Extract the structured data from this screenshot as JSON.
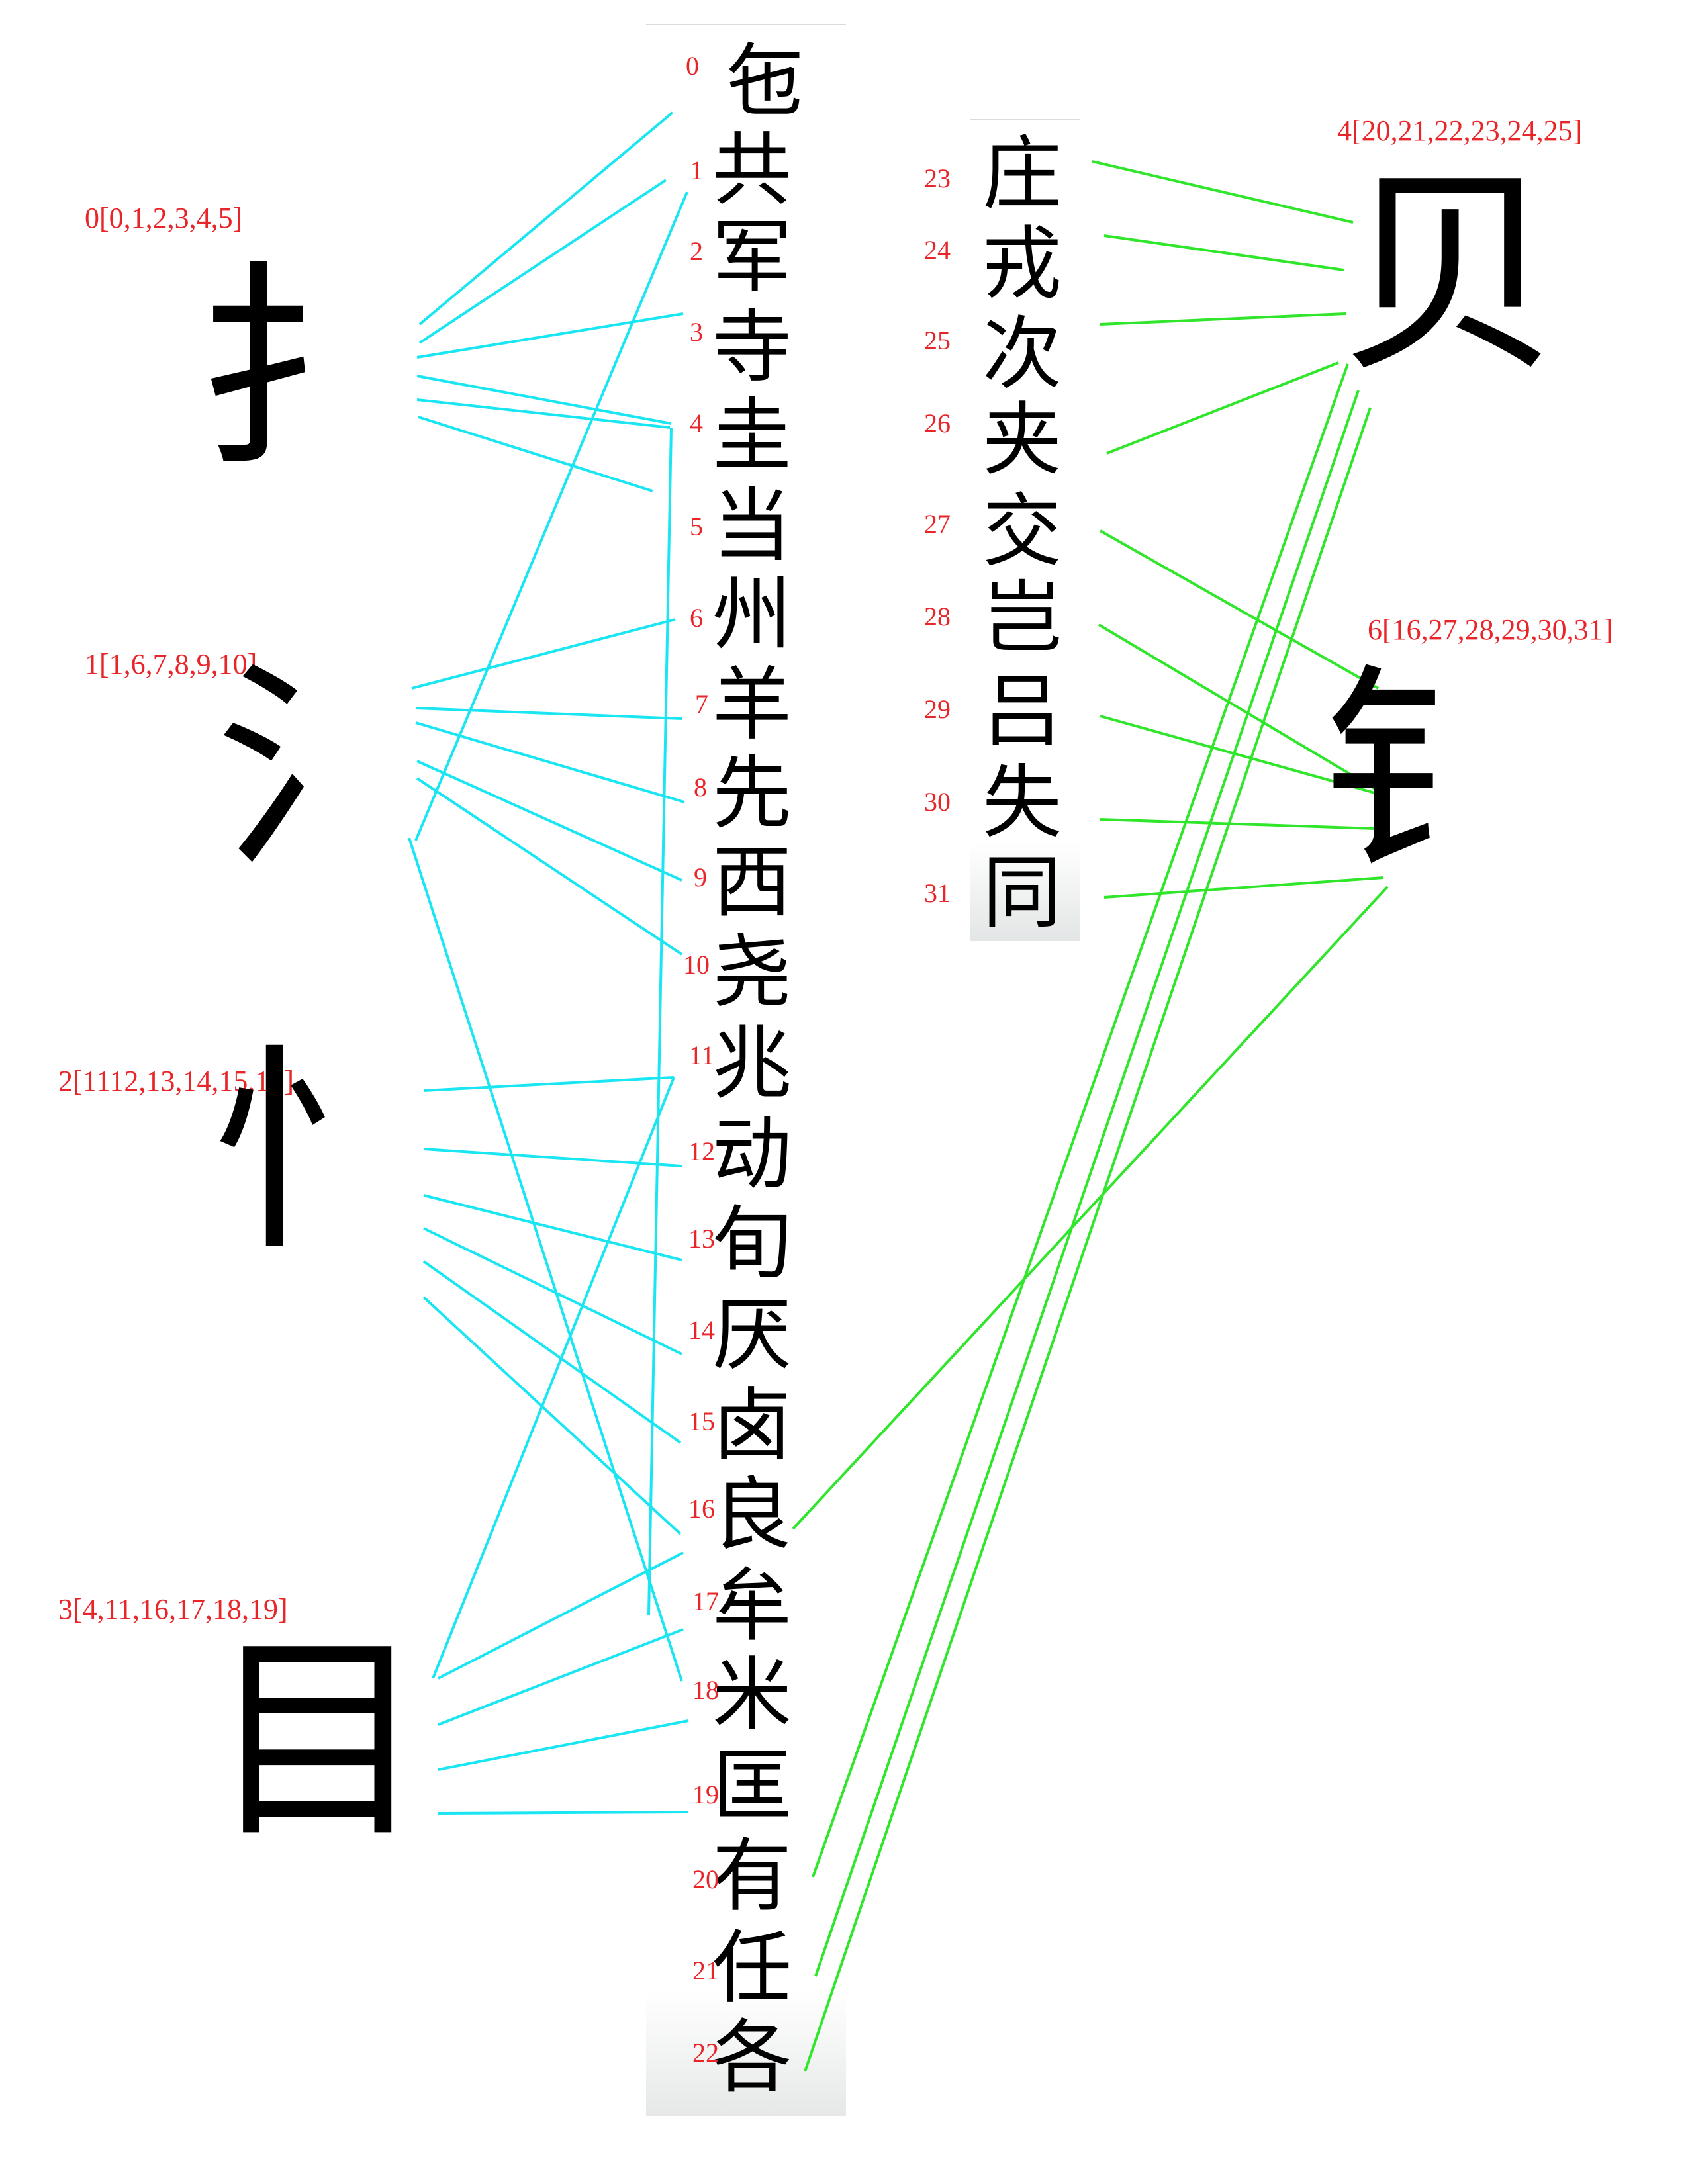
{
  "colors": {
    "label": "#e8262a",
    "link_left": "#19e6f2",
    "link_right": "#2fe62a",
    "text": "#000000"
  },
  "radicals": [
    {
      "id": 0,
      "glyph": "扌",
      "label": "0[0,1,2,3,4,5]"
    },
    {
      "id": 1,
      "glyph": "氵",
      "label": "1[1,6,7,8,9,10]"
    },
    {
      "id": 2,
      "glyph": "忄",
      "label": "2[1112,13,14,15,16]"
    },
    {
      "id": 3,
      "glyph": "目",
      "label": "3[4,11,16,17,18,19]"
    },
    {
      "id": 4,
      "glyph": "贝",
      "label": "4[20,21,22,23,24,25]"
    },
    {
      "id": 6,
      "glyph": "钅",
      "label": "6[16,27,28,29,30,31]"
    }
  ],
  "characters": [
    {
      "index": "0",
      "glyph": "㐌"
    },
    {
      "index": "1",
      "glyph": "共"
    },
    {
      "index": "2",
      "glyph": "军"
    },
    {
      "index": "3",
      "glyph": "寺"
    },
    {
      "index": "4",
      "glyph": "圭"
    },
    {
      "index": "5",
      "glyph": "当"
    },
    {
      "index": "6",
      "glyph": "州"
    },
    {
      "index": "7",
      "glyph": "羊"
    },
    {
      "index": "8",
      "glyph": "先"
    },
    {
      "index": "9",
      "glyph": "西"
    },
    {
      "index": "10",
      "glyph": "尧"
    },
    {
      "index": "11",
      "glyph": "兆"
    },
    {
      "index": "12",
      "glyph": "动"
    },
    {
      "index": "13",
      "glyph": "旬"
    },
    {
      "index": "14",
      "glyph": "厌"
    },
    {
      "index": "15",
      "glyph": "卤"
    },
    {
      "index": "16",
      "glyph": "良"
    },
    {
      "index": "17",
      "glyph": "牟"
    },
    {
      "index": "18",
      "glyph": "米"
    },
    {
      "index": "19",
      "glyph": "匡"
    },
    {
      "index": "20",
      "glyph": "有"
    },
    {
      "index": "21",
      "glyph": "任"
    },
    {
      "index": "22",
      "glyph": "各"
    },
    {
      "index": "23",
      "glyph": "庄"
    },
    {
      "index": "24",
      "glyph": "戎"
    },
    {
      "index": "25",
      "glyph": "次"
    },
    {
      "index": "26",
      "glyph": "夹"
    },
    {
      "index": "27",
      "glyph": "交"
    },
    {
      "index": "28",
      "glyph": "岂"
    },
    {
      "index": "29",
      "glyph": "吕"
    },
    {
      "index": "30",
      "glyph": "失"
    },
    {
      "index": "31",
      "glyph": "同"
    }
  ]
}
